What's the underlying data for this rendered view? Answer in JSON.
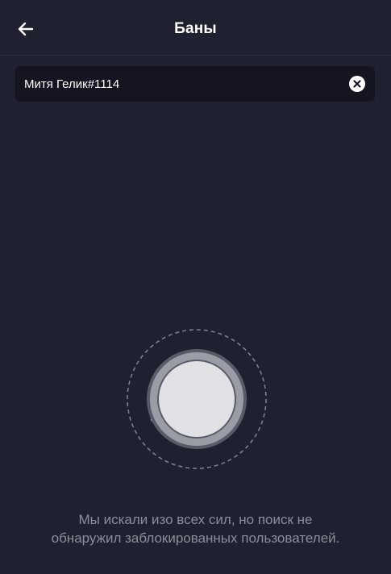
{
  "header": {
    "title": "Баны",
    "back_icon": "arrow-left-icon"
  },
  "search": {
    "value": "Митя Гелик#1114",
    "clear_icon": "clear-circle-x-icon"
  },
  "empty_state": {
    "icon": "magnifying-glass-icon",
    "message": "Мы искали изо всех сил, но поиск не обнаружил заблокированных пользователей."
  },
  "colors": {
    "background": "#1f2030",
    "search_background": "#141520",
    "text_primary": "#ffffff",
    "text_muted": "#8c8e99"
  }
}
